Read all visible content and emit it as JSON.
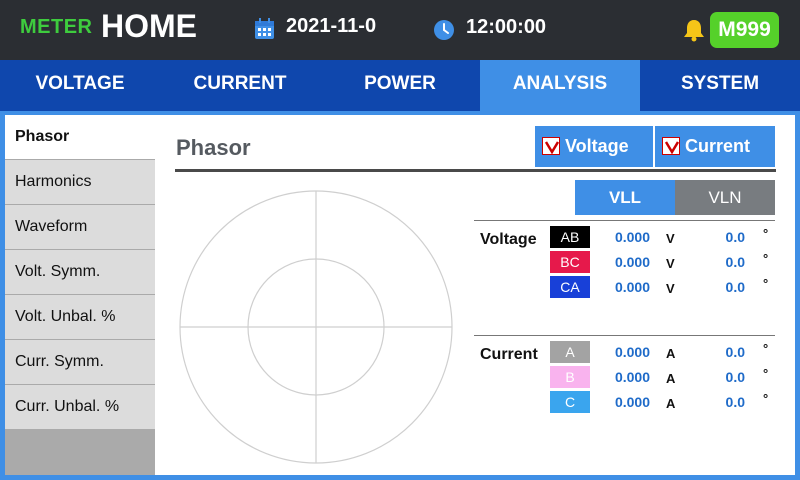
{
  "header": {
    "brand": "METER",
    "title": "HOME",
    "date": "2021-11-0",
    "time": "12:00:00",
    "badge": "M999"
  },
  "tabs": [
    {
      "label": "VOLTAGE",
      "active": false
    },
    {
      "label": "CURRENT",
      "active": false
    },
    {
      "label": "POWER",
      "active": false
    },
    {
      "label": "ANALYSIS",
      "active": true
    },
    {
      "label": "SYSTEM",
      "active": false
    }
  ],
  "sidebar": {
    "items": [
      {
        "label": "Phasor",
        "active": true
      },
      {
        "label": "Harmonics",
        "active": false
      },
      {
        "label": "Waveform",
        "active": false
      },
      {
        "label": "Volt. Symm.",
        "active": false
      },
      {
        "label": "Volt. Unbal. %",
        "active": false
      },
      {
        "label": "Curr. Symm.",
        "active": false
      },
      {
        "label": "Curr. Unbal. %",
        "active": false
      }
    ]
  },
  "panel": {
    "title": "Phasor",
    "toggles": [
      {
        "label": "Voltage",
        "checked": true
      },
      {
        "label": "Current",
        "checked": true
      }
    ],
    "modes": {
      "selected": "VLL",
      "options": [
        "VLL",
        "VLN"
      ]
    }
  },
  "voltage": {
    "label": "Voltage",
    "unit": "V",
    "deg": "°",
    "rows": [
      {
        "phase": "AB",
        "value": "0.000",
        "angle": "0.0",
        "color": "#000000",
        "text_color": "#ffffff"
      },
      {
        "phase": "BC",
        "value": "0.000",
        "angle": "0.0",
        "color": "#e6194b",
        "text_color": "#ffffff"
      },
      {
        "phase": "CA",
        "value": "0.000",
        "angle": "0.0",
        "color": "#1840d8",
        "text_color": "#ffffff"
      }
    ]
  },
  "current": {
    "label": "Current",
    "unit": "A",
    "deg": "°",
    "rows": [
      {
        "phase": "A",
        "value": "0.000",
        "angle": "0.0",
        "color": "#a3a3a3",
        "text_color": "#ffffff"
      },
      {
        "phase": "B",
        "value": "0.000",
        "angle": "0.0",
        "color": "#f9b3ee",
        "text_color": "#ffffff"
      },
      {
        "phase": "C",
        "value": "0.000",
        "angle": "0.0",
        "color": "#3aa5ee",
        "text_color": "#ffffff"
      }
    ]
  },
  "colors": {
    "topbar": "#2b2e33",
    "brand": "#3ecc3e",
    "tabbar": "#0f47ad",
    "accent": "#3f8fe6",
    "badge": "#55d12a",
    "value": "#1f6bc9"
  }
}
